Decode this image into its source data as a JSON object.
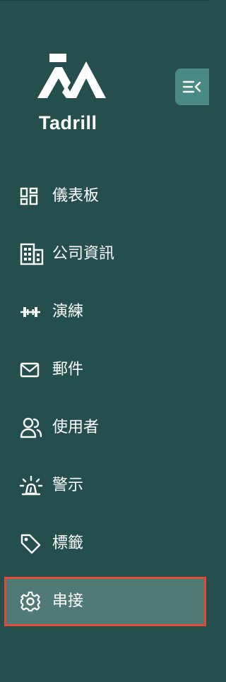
{
  "app": {
    "brand_name": "Tadrill"
  },
  "sidebar": {
    "items": [
      {
        "label": "儀表板",
        "icon": "dashboard-grid-icon"
      },
      {
        "label": "公司資訊",
        "icon": "building-icon"
      },
      {
        "label": "演練",
        "icon": "dumbbell-icon"
      },
      {
        "label": "郵件",
        "icon": "mail-icon"
      },
      {
        "label": "使用者",
        "icon": "users-icon"
      },
      {
        "label": "警示",
        "icon": "alert-siren-icon"
      },
      {
        "label": "標籤",
        "icon": "tag-icon"
      },
      {
        "label": "串接",
        "icon": "gear-icon",
        "active": true
      }
    ]
  },
  "colors": {
    "sidebar_bg": "#244f4c",
    "active_bg": "#517a76",
    "highlight_border": "#e24a33",
    "collapse_button_bg": "#4a8a84"
  }
}
